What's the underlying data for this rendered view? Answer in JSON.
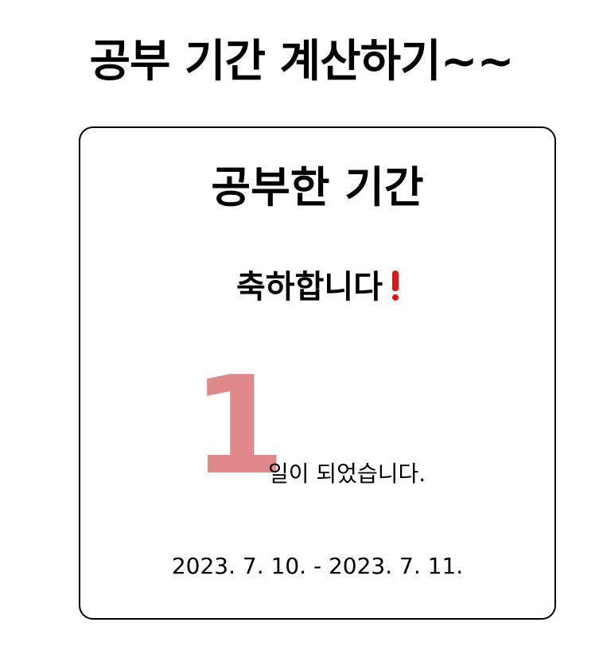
{
  "header": {
    "title": "공부 기간 계산하기~~"
  },
  "card": {
    "title": "공부한 기간",
    "congrats": "축하합니다",
    "congrats_icon": "exclamation-icon",
    "accent_color": "#e0171a",
    "days_number": "1",
    "days_color": "#e0898a",
    "days_suffix": "일이 되었습니다.",
    "date_range": "2023. 7. 10. - 2023. 7. 11."
  }
}
